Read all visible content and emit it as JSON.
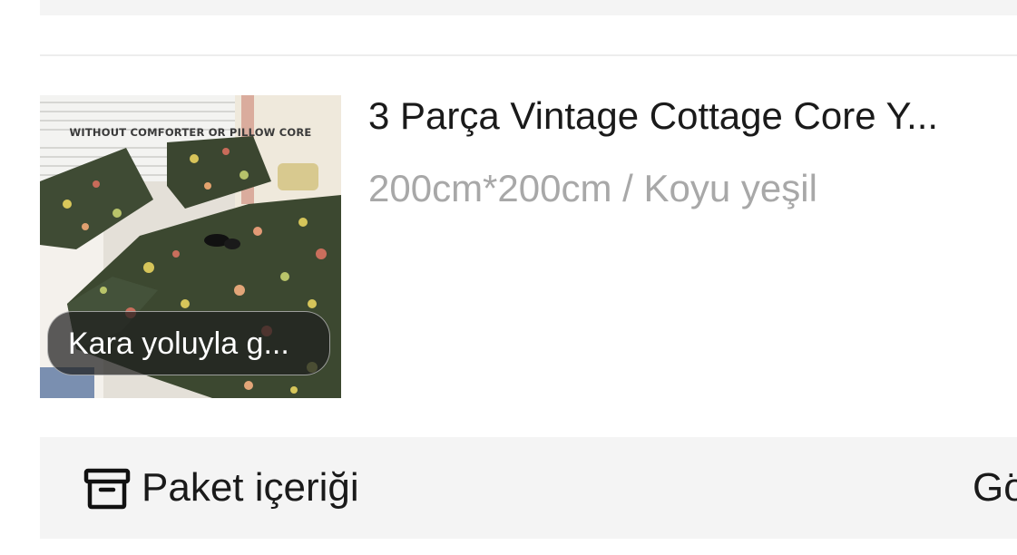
{
  "product": {
    "title": "3 Parça Vintage Cottage Core Y...",
    "variant": "200cm*200cm / Koyu yeşil",
    "image": {
      "caption": "WITHOUT COMFORTER OR PILLOW CORE",
      "shipping_badge": "Kara yoluyla g..."
    }
  },
  "package": {
    "label": "Paket içeriği",
    "icon": "archive-box-icon",
    "link_label": "Gö"
  },
  "colors": {
    "title_text": "#1a1a1a",
    "variant_text": "#a8a8a8",
    "section_background": "#f4f4f4",
    "badge_background": "#1e1e1e"
  }
}
